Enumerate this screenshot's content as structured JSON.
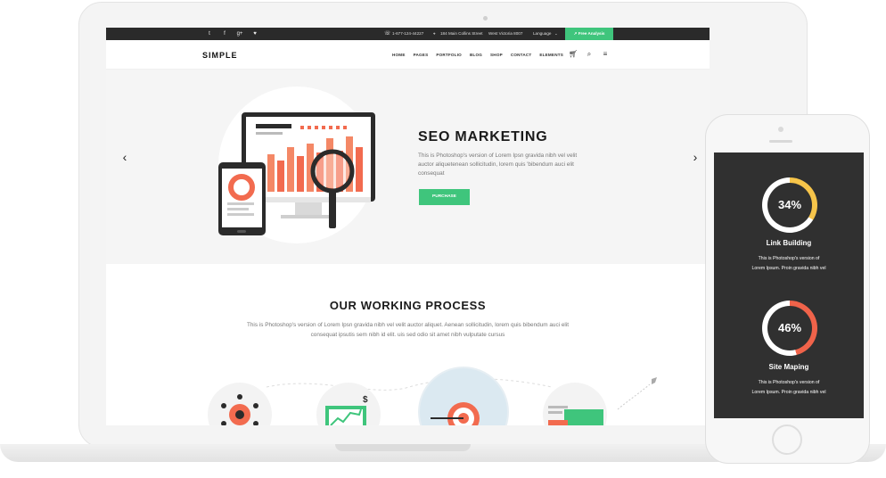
{
  "topbar": {
    "social": [
      {
        "icon": "twitter-icon",
        "glyph": "t"
      },
      {
        "icon": "facebook-icon",
        "glyph": "f"
      },
      {
        "icon": "google-plus-icon",
        "glyph": "g+"
      },
      {
        "icon": "heart-icon",
        "glyph": "♥"
      }
    ],
    "phone": "1-677-124-44227",
    "address": "184 Main Collins Street",
    "city": "West Victoria 8007",
    "language": "Language",
    "cta": "Free Analysis"
  },
  "nav": {
    "logo": "SIMPLE",
    "items": [
      "HOME",
      "PAGES",
      "PORTFOLIO",
      "BLOG",
      "SHOP",
      "CONTACT",
      "ELEMENTS"
    ]
  },
  "hero": {
    "title": "SEO MARKETING",
    "text": "This is Photoshop's version  of Lorem Ipsn gravida nibh vel velit auctor aliquetenean sollicitudin, lorem quis 'bibendum auci elit consequat",
    "button": "PURCHASE"
  },
  "process": {
    "title": "OUR WORKING PROCESS",
    "text": "This is Photoshop's version  of Lorem Ipsn gravida nibh vel velit auctor aliquet. Aenean sollicitudin, lorem quis bibendum auci elit consequat ipsutis sem nibh id elit. uis sed odio sit amet nibh vulputate cursus"
  },
  "phone": {
    "stats": [
      {
        "value": "34%",
        "percent": 34,
        "color": "#f7c54a",
        "title": "Link Building",
        "text_1": "This is Photoshop's version  of",
        "text_2": "Lorem Ipsum. Proin gravida nibh vel"
      },
      {
        "value": "46%",
        "percent": 46,
        "color": "#f0634a",
        "title": "Site Maping",
        "text_1": "This is Photoshop's version  of",
        "text_2": "Lorem Ipsum. Proin gravida nibh vel"
      }
    ]
  },
  "colors": {
    "accent": "#3fc57c",
    "orange": "#f0634a",
    "yellow": "#f7c54a",
    "dark": "#2a2a2a"
  }
}
